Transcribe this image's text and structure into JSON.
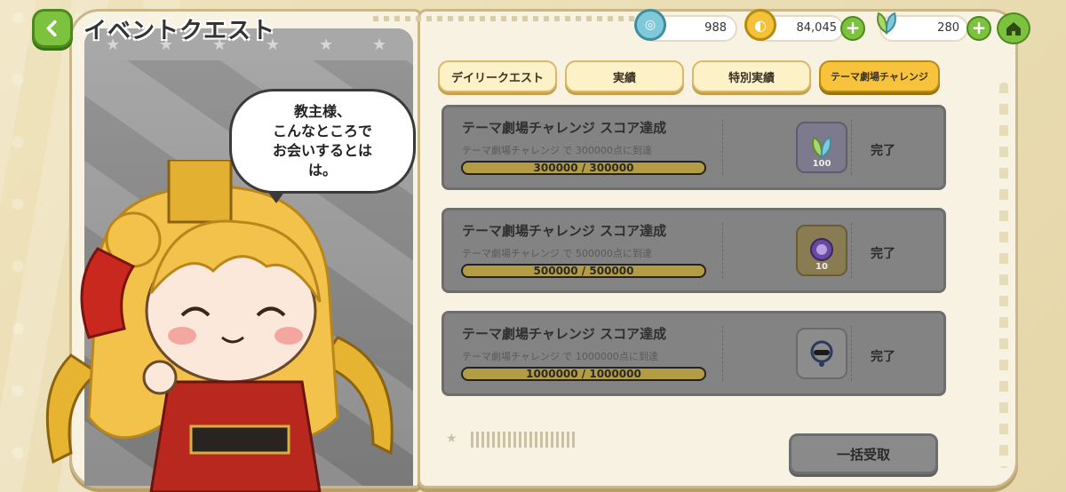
{
  "header": {
    "title": "イベントクエスト"
  },
  "currency": [
    {
      "name": "medal",
      "value": "988",
      "color": "#7fc9d8"
    },
    {
      "name": "coin",
      "value": "84,045",
      "color": "#f2c33a"
    },
    {
      "name": "leaf",
      "value": "280",
      "color": "#a6d86a"
    }
  ],
  "tabs": [
    {
      "label": "デイリークエスト",
      "active": false
    },
    {
      "label": "実績",
      "active": false
    },
    {
      "label": "特別実績",
      "active": false
    },
    {
      "label": "テーマ劇場チャレンジ",
      "active": true
    }
  ],
  "speech": {
    "lines": [
      "教主様、",
      "こんなところで",
      "お会いするとは",
      "は。"
    ]
  },
  "quests": [
    {
      "title": "テーマ劇場チャレンジ スコア達成",
      "desc": "テーマ劇場チャレンジ で 300000点に到達",
      "progress_text": "300000 / 300000",
      "progress": 1.0,
      "reward_icon": "leaf-icon",
      "reward_count": "100",
      "status": "完了"
    },
    {
      "title": "テーマ劇場チャレンジ スコア達成",
      "desc": "テーマ劇場チャレンジ で 500000点に到達",
      "progress_text": "500000 / 500000",
      "progress": 1.0,
      "reward_icon": "medal-icon",
      "reward_count": "10",
      "status": "完了"
    },
    {
      "title": "テーマ劇場チャレンジ スコア達成",
      "desc": "テーマ劇場チャレンジ で 1000000点に到達",
      "progress_text": "1000000 / 1000000",
      "progress": 1.0,
      "reward_icon": "accessory-icon",
      "reward_count": "",
      "status": "完了"
    }
  ],
  "claim_all": "一括受取"
}
